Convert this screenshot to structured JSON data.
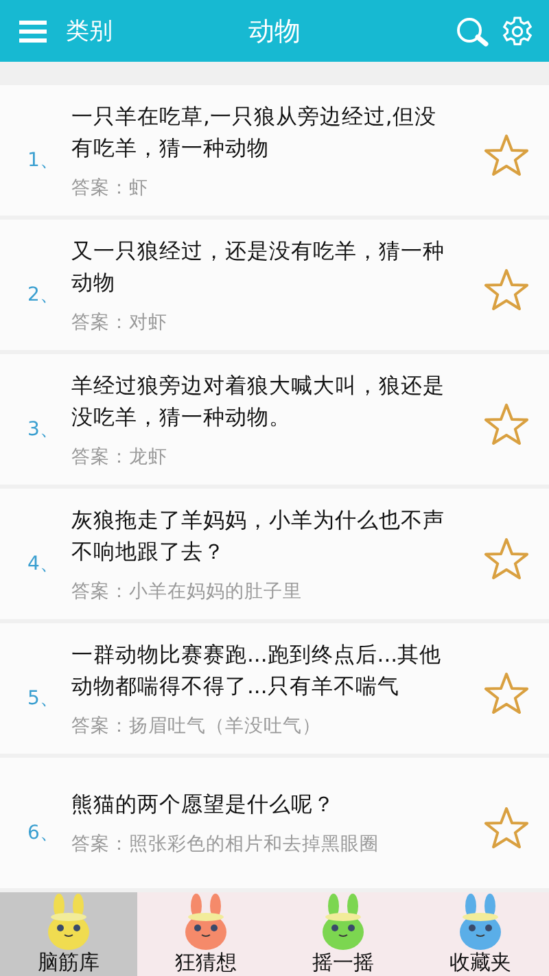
{
  "header": {
    "menu_label": "类别",
    "title": "动物"
  },
  "questions": [
    {
      "number": "1、",
      "question": "一只羊在吃草,一只狼从旁边经过,但没有吃羊，猜一种动物",
      "answer": "答案：虾",
      "starred": false
    },
    {
      "number": "2、",
      "question": "又一只狼经过，还是没有吃羊，猜一种动物",
      "answer": "答案：对虾",
      "starred": false
    },
    {
      "number": "3、",
      "question": "羊经过狼旁边对着狼大喊大叫，狼还是没吃羊，猜一种动物。",
      "answer": "答案：龙虾",
      "starred": false
    },
    {
      "number": "4、",
      "question": "灰狼拖走了羊妈妈，小羊为什么也不声不响地跟了去？",
      "answer": "答案：小羊在妈妈的肚子里",
      "starred": false
    },
    {
      "number": "5、",
      "question": "一群动物比赛赛跑...跑到终点后...其他动物都喘得不得了...只有羊不喘气",
      "answer": "答案：扬眉吐气（羊没吐气）",
      "starred": false
    },
    {
      "number": "6、",
      "question": "熊猫的两个愿望是什么呢？",
      "answer": "答案：照张彩色的相片和去掉黑眼圈",
      "starred": false
    }
  ],
  "nav": [
    {
      "label": "脑筋库",
      "color": "#f0dc50",
      "selected": true
    },
    {
      "label": "狂猜想",
      "color": "#f58a6a",
      "selected": false
    },
    {
      "label": "摇一摇",
      "color": "#7cd650",
      "selected": false
    },
    {
      "label": "收藏夹",
      "color": "#5aaee8",
      "selected": false
    }
  ]
}
